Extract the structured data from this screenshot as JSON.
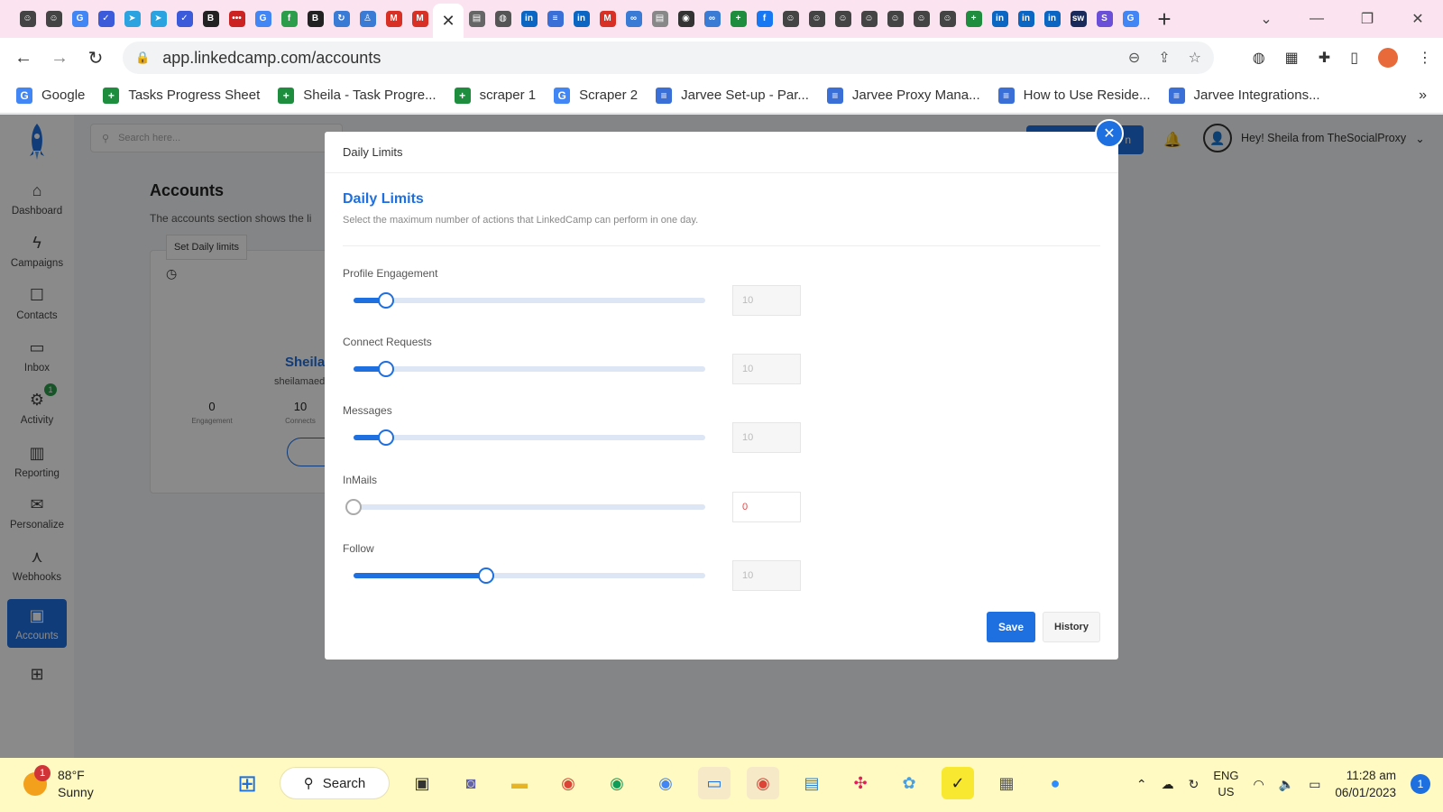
{
  "browser": {
    "url": "app.linkedcamp.com/accounts",
    "close_tab_glyph": "✕",
    "new_tab_glyph": "+",
    "tab_favicons": [
      {
        "icon": "smiley-icon",
        "color": "#444444",
        "glyph": "☺"
      },
      {
        "icon": "smiley-icon",
        "color": "#444444",
        "glyph": "☺"
      },
      {
        "icon": "google-icon",
        "color": "#4285f4",
        "glyph": "G"
      },
      {
        "icon": "check-icon",
        "color": "#3b5bdb",
        "glyph": "✓"
      },
      {
        "icon": "telegram-icon",
        "color": "#2aa3e0",
        "glyph": "➤"
      },
      {
        "icon": "telegram-icon",
        "color": "#2aa3e0",
        "glyph": "➤"
      },
      {
        "icon": "check-icon",
        "color": "#3b5bdb",
        "glyph": "✓"
      },
      {
        "icon": "bold-b-icon",
        "color": "#222222",
        "glyph": "B"
      },
      {
        "icon": "dots-icon",
        "color": "#cc2222",
        "glyph": "•••"
      },
      {
        "icon": "google-icon",
        "color": "#4285f4",
        "glyph": "G"
      },
      {
        "icon": "circle-f-icon",
        "color": "#2c9e4b",
        "glyph": "f"
      },
      {
        "icon": "bh-icon",
        "color": "#222222",
        "glyph": "B"
      },
      {
        "icon": "sync-icon",
        "color": "#3a7bd5",
        "glyph": "↻"
      },
      {
        "icon": "person-icon",
        "color": "#3a7bd5",
        "glyph": "♙"
      },
      {
        "icon": "gmail-icon",
        "color": "#d93025",
        "glyph": "M"
      },
      {
        "icon": "gmail-icon",
        "color": "#d93025",
        "glyph": "M"
      }
    ],
    "tab_favicons_after": [
      {
        "icon": "doc-icon",
        "color": "#666666",
        "glyph": "▤"
      },
      {
        "icon": "globe-icon",
        "color": "#555555",
        "glyph": "◍"
      },
      {
        "icon": "linkedin-icon",
        "color": "#0a66c2",
        "glyph": "in"
      },
      {
        "icon": "docs-icon",
        "color": "#3b6fd8",
        "glyph": "≡"
      },
      {
        "icon": "linkedin-icon",
        "color": "#0a66c2",
        "glyph": "in"
      },
      {
        "icon": "gmail-icon",
        "color": "#d93025",
        "glyph": "M"
      },
      {
        "icon": "link-icon",
        "color": "#3a7bd5",
        "glyph": "∞"
      },
      {
        "icon": "doc-icon",
        "color": "#888888",
        "glyph": "▤"
      },
      {
        "icon": "camera-icon",
        "color": "#333333",
        "glyph": "◉"
      },
      {
        "icon": "link-icon",
        "color": "#3a7bd5",
        "glyph": "∞"
      },
      {
        "icon": "sheets-icon",
        "color": "#1e8e3e",
        "glyph": "+"
      },
      {
        "icon": "facebook-icon",
        "color": "#1877f2",
        "glyph": "f"
      },
      {
        "icon": "smiley-icon",
        "color": "#444444",
        "glyph": "☺"
      },
      {
        "icon": "smiley-icon",
        "color": "#444444",
        "glyph": "☺"
      },
      {
        "icon": "smiley-icon",
        "color": "#444444",
        "glyph": "☺"
      },
      {
        "icon": "smiley-icon",
        "color": "#444444",
        "glyph": "☺"
      },
      {
        "icon": "smiley-icon",
        "color": "#444444",
        "glyph": "☺"
      },
      {
        "icon": "smiley-icon",
        "color": "#444444",
        "glyph": "☺"
      },
      {
        "icon": "smiley-icon",
        "color": "#444444",
        "glyph": "☺"
      },
      {
        "icon": "sheets-icon",
        "color": "#1e8e3e",
        "glyph": "+"
      },
      {
        "icon": "linkedin-icon",
        "color": "#0a66c2",
        "glyph": "in"
      },
      {
        "icon": "linkedin-icon",
        "color": "#0a66c2",
        "glyph": "in"
      },
      {
        "icon": "linkedin-icon",
        "color": "#0a66c2",
        "glyph": "in"
      },
      {
        "icon": "sw-icon",
        "color": "#1a2a5a",
        "glyph": "sw"
      },
      {
        "icon": "s-icon",
        "color": "#6b4fd8",
        "glyph": "S"
      },
      {
        "icon": "google-icon",
        "color": "#4285f4",
        "glyph": "G"
      }
    ],
    "bookmarks": [
      {
        "label": "Google",
        "icon": "google-icon",
        "color": "#4285f4",
        "glyph": "G"
      },
      {
        "label": "Tasks Progress Sheet",
        "icon": "sheets-icon",
        "color": "#1e8e3e",
        "glyph": "+"
      },
      {
        "label": "Sheila - Task Progre...",
        "icon": "sheets-icon",
        "color": "#1e8e3e",
        "glyph": "+"
      },
      {
        "label": "scraper 1",
        "icon": "sheets-icon",
        "color": "#1e8e3e",
        "glyph": "+"
      },
      {
        "label": "Scraper 2",
        "icon": "google-icon",
        "color": "#4285f4",
        "glyph": "G"
      },
      {
        "label": "Jarvee Set-up - Par...",
        "icon": "docs-icon",
        "color": "#3b6fd8",
        "glyph": "≡"
      },
      {
        "label": "Jarvee Proxy Mana...",
        "icon": "docs-icon",
        "color": "#3b6fd8",
        "glyph": "≡"
      },
      {
        "label": "How to Use Reside...",
        "icon": "docs-icon",
        "color": "#3b6fd8",
        "glyph": "≡"
      },
      {
        "label": "Jarvee Integrations...",
        "icon": "docs-icon",
        "color": "#3b6fd8",
        "glyph": "≡"
      }
    ],
    "bookmarks_more": "»"
  },
  "app": {
    "search_placeholder": "Search here...",
    "header_button_label": "n",
    "user_greeting": "Hey! Sheila from TheSocialProxy",
    "nav": [
      {
        "label": "Dashboard",
        "icon": "home-icon",
        "glyph": "⌂"
      },
      {
        "label": "Campaigns",
        "icon": "bolt-icon",
        "glyph": "ϟ"
      },
      {
        "label": "Contacts",
        "icon": "contacts-icon",
        "glyph": "☐"
      },
      {
        "label": "Inbox",
        "icon": "chat-icon",
        "glyph": "▭"
      },
      {
        "label": "Activity",
        "icon": "activity-icon",
        "glyph": "⚙",
        "badge": "1"
      },
      {
        "label": "Reporting",
        "icon": "bar-chart-icon",
        "glyph": "▥"
      },
      {
        "label": "Personalize",
        "icon": "mail-icon",
        "glyph": "✉"
      },
      {
        "label": "Webhooks",
        "icon": "webhook-icon",
        "glyph": "⋏"
      },
      {
        "label": "Accounts",
        "icon": "accounts-icon",
        "glyph": "▣",
        "active": true
      },
      {
        "label": "",
        "icon": "sitemap-icon",
        "glyph": "⊞"
      }
    ],
    "page": {
      "title": "Accounts",
      "description": "The accounts section shows the li",
      "tooltip": "Set Daily limits",
      "card_name": "Sheila",
      "card_email": "sheilamaed",
      "stats": [
        {
          "value": "0",
          "label": "Engagement"
        },
        {
          "value": "10",
          "label": "Connects"
        }
      ]
    }
  },
  "modal": {
    "header": "Daily Limits",
    "title": "Daily Limits",
    "subtitle": "Select the maximum number of actions that LinkedCamp can perform in one day.",
    "close_glyph": "✕",
    "limits": [
      {
        "label": "Profile Engagement",
        "value": "10",
        "fraction": 0.092
      },
      {
        "label": "Connect Requests",
        "value": "10",
        "fraction": 0.092
      },
      {
        "label": "Messages",
        "value": "10",
        "fraction": 0.092
      },
      {
        "label": "InMails",
        "value": "0",
        "fraction": 0
      },
      {
        "label": "Follow",
        "value": "10",
        "fraction": 0.377
      }
    ],
    "save_label": "Save",
    "history_label": "History"
  },
  "taskbar": {
    "weather_temp": "88°F",
    "weather_cond": "Sunny",
    "weather_badge": "1",
    "search_label": "Search",
    "lang_1": "ENG",
    "lang_2": "US",
    "time": "11:28 am",
    "date": "06/01/2023",
    "notif_count": "1"
  }
}
